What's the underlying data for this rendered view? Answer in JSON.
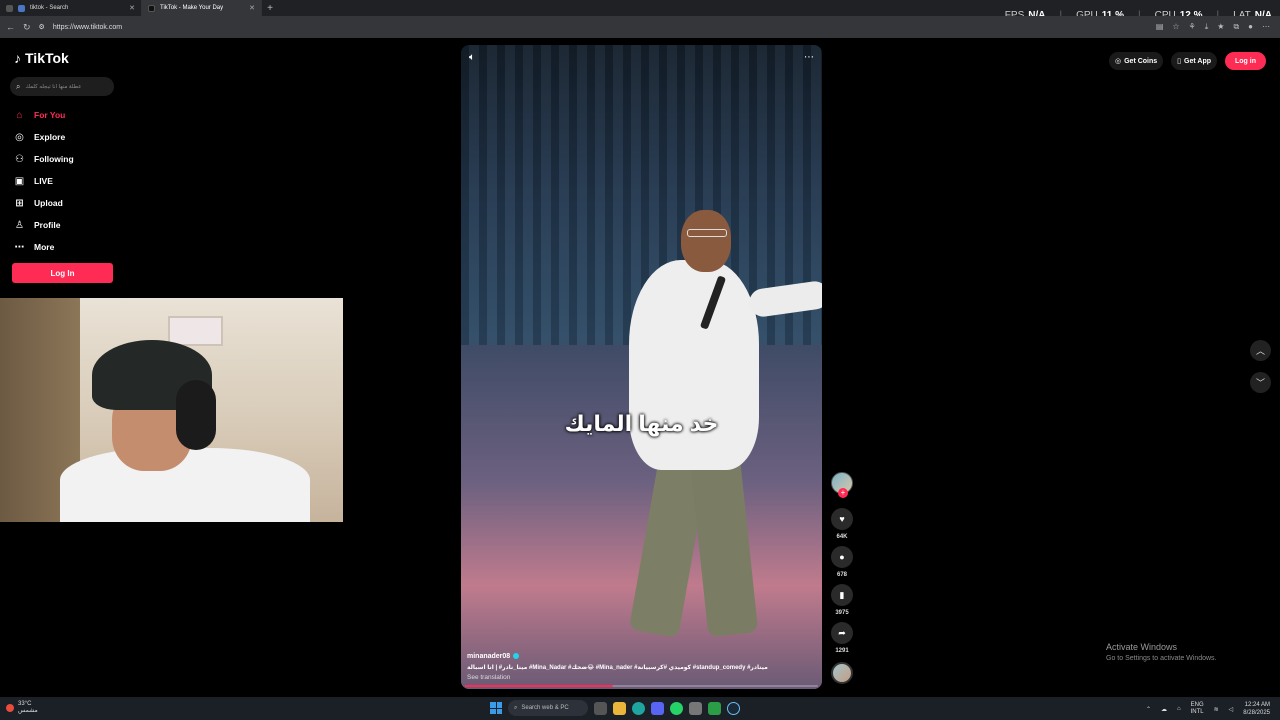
{
  "browser": {
    "tabs": [
      {
        "title": "tiktok - Search",
        "active": false
      },
      {
        "title": "TikTok - Make Your Day",
        "active": true
      }
    ],
    "url": "https://www.tiktok.com"
  },
  "perf_overlay": {
    "fps_label": "FPS",
    "fps_value": "N/A",
    "gpu_label": "GPU",
    "gpu_value": "11 %",
    "cpu_label": "CPU",
    "cpu_value": "12 %",
    "lat_label": "LAT",
    "lat_value": "N/A"
  },
  "sidebar": {
    "brand": "TikTok",
    "search_placeholder": "عطلة منها انا تبجله كلمك",
    "items": [
      {
        "label": "For You",
        "icon": "home-icon",
        "active": true
      },
      {
        "label": "Explore",
        "icon": "compass-icon"
      },
      {
        "label": "Following",
        "icon": "following-icon"
      },
      {
        "label": "LIVE",
        "icon": "live-icon"
      },
      {
        "label": "Upload",
        "icon": "upload-icon"
      },
      {
        "label": "Profile",
        "icon": "profile-icon"
      },
      {
        "label": "More",
        "icon": "more-icon"
      }
    ],
    "login_label": "Log In"
  },
  "header": {
    "get_coins": "Get Coins",
    "get_app": "Get App",
    "login": "Log in"
  },
  "video": {
    "caption_text": "خد منها المايك",
    "username": "minanader08",
    "tags": "مينا_نادر# | انا اسبالة #Mina_Nadar #ضحك😂 #Mina_nader #كوميدي #كرسبيانة #standup_comedy #مينادر",
    "see_translation": "See translation",
    "progress_fraction": 0.42
  },
  "actions": {
    "likes": "64K",
    "comments": "678",
    "saves": "3975",
    "shares": "1291"
  },
  "windows_watermark": {
    "line1": "Activate Windows",
    "line2": "Go to Settings to activate Windows."
  },
  "taskbar": {
    "weather_temp": "33°C",
    "weather_text": "مشمس",
    "search_placeholder": "Search web & PC",
    "lang_top": "ENG",
    "lang_bottom": "INTL",
    "time": "12:24 AM",
    "date": "8/28/2025"
  }
}
